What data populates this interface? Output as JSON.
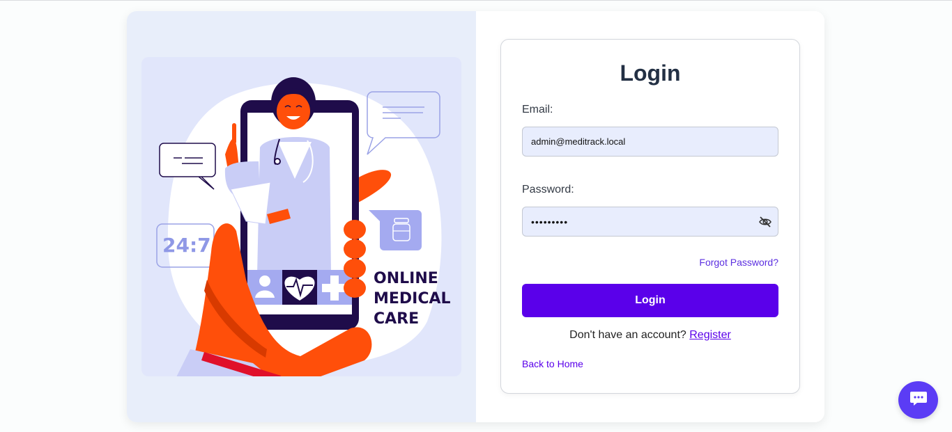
{
  "illustration": {
    "badge_text": "24:7",
    "headline_lines": [
      "ONLINE",
      "MEDICAL",
      "CARE"
    ]
  },
  "login": {
    "title": "Login",
    "email_label": "Email:",
    "email_value": "admin@meditrack.local",
    "password_label": "Password:",
    "password_value": "•••••••••",
    "forgot_password": "Forgot Password?",
    "submit_label": "Login",
    "no_account_text": "Don't have an account?",
    "register_link": "Register",
    "back_home": "Back to Home"
  },
  "icons": {
    "password_toggle": "eye-slash-icon",
    "chat": "chat-bubble-icon"
  },
  "colors": {
    "accent": "#5a00ea",
    "input_bg": "#e8edfd",
    "left_panel_bg": "#e8eefa",
    "illustration_orange": "#ff4f0a",
    "illustration_navy": "#1f0c4a",
    "chat_button": "#5b3cf5"
  }
}
